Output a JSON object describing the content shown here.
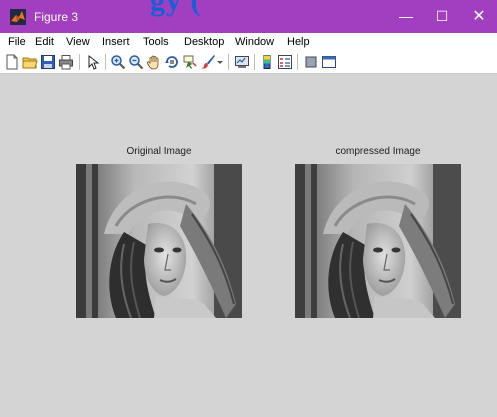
{
  "window": {
    "title": "Figure 3",
    "overlay_text": "gy (",
    "controls": {
      "minimize": "—",
      "maximize": "☐",
      "close": "✕"
    },
    "accent_color": "#a23ec0"
  },
  "menu": {
    "items": [
      "File",
      "Edit",
      "View",
      "Insert",
      "Tools",
      "Desktop",
      "Window",
      "Help"
    ]
  },
  "toolbar": {
    "icons": [
      "new-figure-icon",
      "open-file-icon",
      "save-icon",
      "print-icon",
      "edit-plot-arrow-icon",
      "zoom-in-icon",
      "zoom-out-icon",
      "pan-hand-icon",
      "rotate-3d-icon",
      "data-cursor-icon",
      "brush-icon",
      "link-plot-icon",
      "colorbar-icon",
      "legend-icon",
      "hide-plot-tools-icon",
      "show-plot-tools-icon"
    ]
  },
  "figure": {
    "axes": [
      {
        "title": "Original Image",
        "content": "grayscale-portrait-image"
      },
      {
        "title": "compressed  Image",
        "content": "grayscale-portrait-image"
      }
    ]
  }
}
